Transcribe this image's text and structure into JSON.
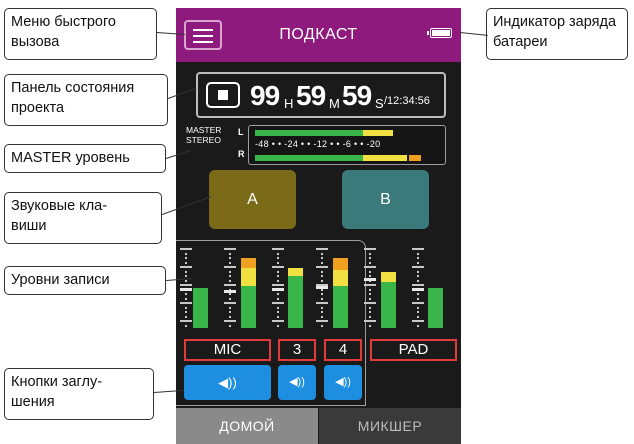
{
  "topbar": {
    "title": "ПОДКАСТ"
  },
  "status": {
    "hours": "99",
    "hours_unit": "H",
    "minutes": "59",
    "minutes_unit": "M",
    "seconds": "59",
    "seconds_unit": "S",
    "total": "/12:34:56"
  },
  "master": {
    "label": "MASTER\nSTEREO",
    "label_l": "L",
    "label_r": "R",
    "scale": "-48 • • -24 • • -12 • • -6 • • -20",
    "level_l": 0.7,
    "level_r": 0.85
  },
  "pads": {
    "a_label": "A",
    "b_label": "B"
  },
  "channels": {
    "mic_label": "MIC",
    "ch3_label": "3",
    "ch4_label": "4",
    "pad_label": "PAD"
  },
  "tabs": {
    "home": "ДОМОЙ",
    "mixer": "МИКШЕР"
  },
  "callouts": {
    "menu": "Меню быстрого вызова",
    "status": "Панель состояния проекта",
    "master": "MASTER уровень",
    "pads": "Звуковые кла-\nвиши",
    "levels": "Уровни записи",
    "mute": "Кнопки заглу-\nшения",
    "battery": "Индикатор заряда батареи"
  },
  "colors": {
    "header": "#8e1a7e",
    "pad_a": "#7a6a18",
    "pad_b": "#3a7a7a",
    "meter_green": "#3ab54a",
    "meter_yellow": "#f0e040",
    "meter_orange": "#f0a020",
    "mute": "#1e8fe0",
    "label_border": "#e33b3b"
  },
  "icons": {
    "menu": "hamburger-icon",
    "battery": "battery-icon",
    "stop": "stop-icon",
    "mute": "speaker-icon"
  }
}
